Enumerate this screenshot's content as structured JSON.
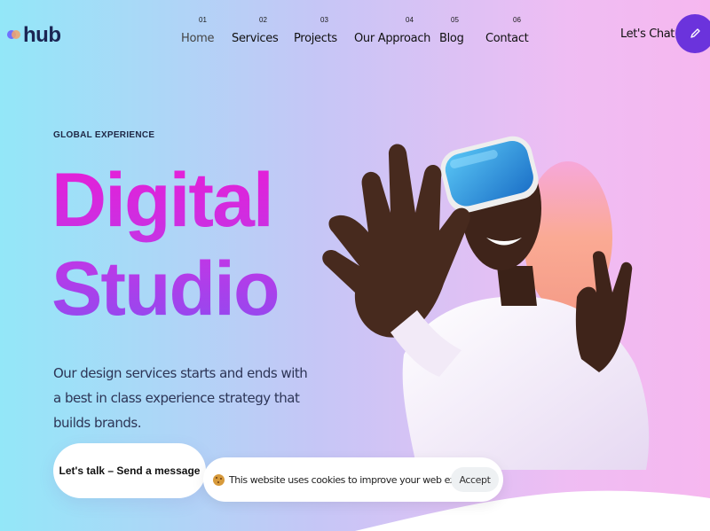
{
  "brand": {
    "name": "hub"
  },
  "nav": {
    "items": [
      {
        "num": "01",
        "label": "Home",
        "active": true
      },
      {
        "num": "02",
        "label": "Services"
      },
      {
        "num": "03",
        "label": "Projects"
      },
      {
        "num": "04",
        "label": "Our Approach"
      },
      {
        "num": "05",
        "label": "Blog"
      },
      {
        "num": "06",
        "label": "Contact"
      }
    ],
    "chat_label": "Let's Chat",
    "chat_icon": "pencil-icon"
  },
  "hero": {
    "eyebrow": "GLOBAL EXPERIENCE",
    "headline_line1": "Digital",
    "headline_line2": "Studio",
    "description": "Our design services starts and ends with a best in class experience strategy that builds brands.",
    "cta_label": "Let's talk – Send a message",
    "image_subject": "person-with-vr-headset"
  },
  "cookie": {
    "icon": "cookie-icon",
    "text": "This website uses cookies to improve your web experience.",
    "accept_label": "Accept"
  },
  "colors": {
    "accent": "#6b33dc",
    "headline_top": "#e81dd6",
    "headline_bottom": "#8d4cf0",
    "background_left": "#93e7f8",
    "background_right": "#f6b7ef"
  }
}
